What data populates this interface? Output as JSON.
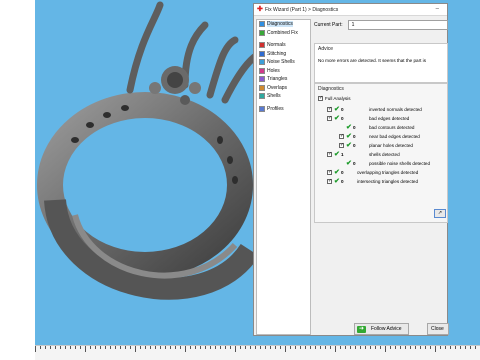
{
  "colors": {
    "viewport_bg": "#64b6e6",
    "model": "#6f6f6f",
    "accent": "#2f8ee0",
    "check": "#1c9a2a"
  },
  "dialog": {
    "title": "Fix Wizard (Part 1) > Diagnostics",
    "title_icon": "red-cross-icon",
    "minimize_glyph": "–"
  },
  "sidebar": {
    "items": [
      {
        "label": "Diagnostics",
        "icon": "diagnostics-icon",
        "selected": true
      },
      {
        "label": "Combined Fix",
        "icon": "combined-fix-icon"
      },
      {
        "label": "Normals",
        "icon": "normals-icon"
      },
      {
        "label": "Stitching",
        "icon": "stitching-icon"
      },
      {
        "label": "Noise Shells",
        "icon": "noise-shells-icon"
      },
      {
        "label": "Holes",
        "icon": "holes-icon"
      },
      {
        "label": "Triangles",
        "icon": "triangles-icon"
      },
      {
        "label": "Overlaps",
        "icon": "overlaps-icon"
      },
      {
        "label": "Shells",
        "icon": "shells-icon"
      },
      {
        "label": "Profiles",
        "icon": "profiles-icon"
      }
    ]
  },
  "current_part": {
    "label": "Current Part:",
    "value": "1"
  },
  "advice": {
    "title": "Advice",
    "message": "No more errors are detected. It seems that the part is"
  },
  "diagnostics": {
    "title": "Diagnostics",
    "full_analysis_label": "Full Analysis",
    "rows": [
      {
        "count": "0",
        "label": "inverted normals detected"
      },
      {
        "count": "0",
        "label": "bad edges detected"
      },
      {
        "count": "0",
        "label": "bad contours detected"
      },
      {
        "count": "0",
        "label": "near bad edges detected"
      },
      {
        "count": "0",
        "label": "planar holes detected"
      },
      {
        "count": "1",
        "label": "shells detected"
      },
      {
        "count": "0",
        "label": "possible noise shells detected"
      },
      {
        "count": "0",
        "label": "overlapping triangles detected"
      },
      {
        "count": "0",
        "label": "intersecting triangles detected"
      }
    ],
    "small_button_label": "↗"
  },
  "buttons": {
    "follow_advice": "Follow Advice",
    "close": "Close"
  }
}
